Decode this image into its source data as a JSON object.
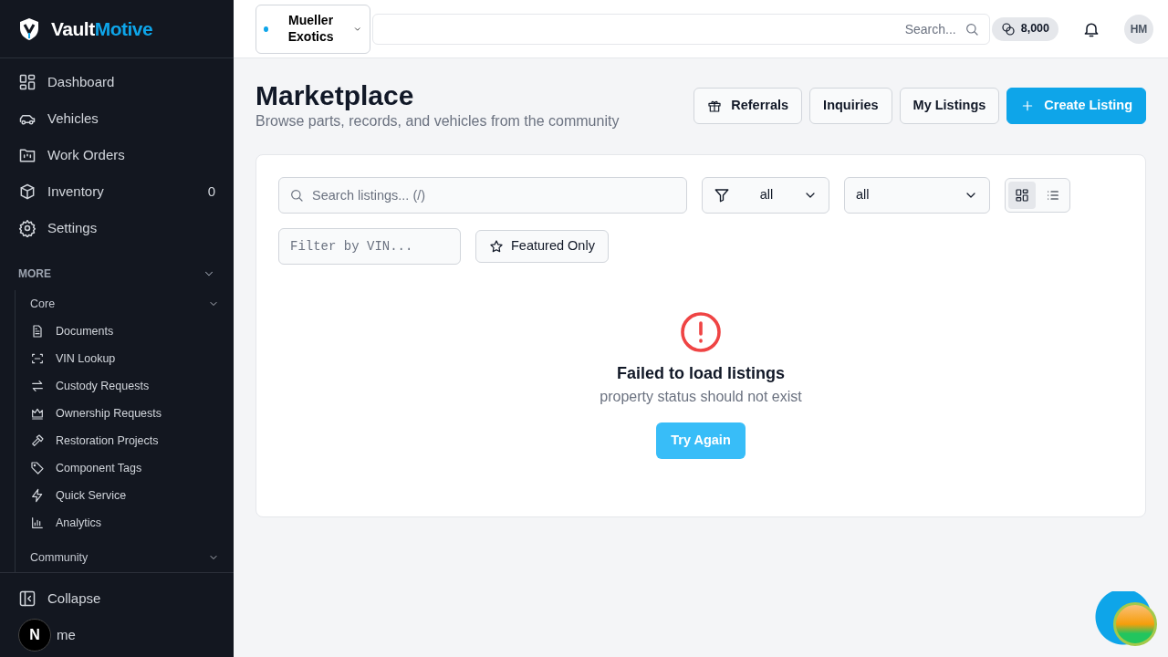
{
  "brand": {
    "part_1": "Vault",
    "part_2": "Motive"
  },
  "sidebar": {
    "items": [
      {
        "label": "Dashboard"
      },
      {
        "label": "Vehicles"
      },
      {
        "label": "Work Orders"
      },
      {
        "label": "Inventory",
        "count": "0"
      },
      {
        "label": "Settings"
      }
    ],
    "more": {
      "label": "MORE",
      "expanded": true,
      "groups": [
        {
          "label": "Core",
          "expanded": true,
          "items": [
            {
              "label": "Documents"
            },
            {
              "label": "VIN Lookup"
            },
            {
              "label": "Custody Requests"
            },
            {
              "label": "Ownership Requests"
            },
            {
              "label": "Restoration Projects"
            },
            {
              "label": "Component Tags"
            },
            {
              "label": "Quick Service"
            },
            {
              "label": "Analytics"
            }
          ]
        },
        {
          "label": "Community",
          "expanded": true
        }
      ]
    },
    "footer": [
      {
        "label": "Collapse"
      },
      {
        "label": "me"
      }
    ],
    "dev_badge": "N"
  },
  "topbar": {
    "workspace": {
      "name": "Mueller Exotics",
      "color": "#0ea5e9"
    },
    "search": {
      "placeholder": "Search..."
    },
    "credits": "8,000",
    "avatar": "HM"
  },
  "page": {
    "title": "Marketplace",
    "subtitle": "Browse parts, records, and vehicles from the community",
    "actions": [
      {
        "label": "Referrals",
        "kind": "gift"
      },
      {
        "label": "Inquiries",
        "kind": "plain"
      },
      {
        "label": "My Listings",
        "kind": "plain"
      },
      {
        "label": "Create Listing",
        "kind": "primary"
      }
    ]
  },
  "filters": {
    "search": {
      "placeholder": "Search listings... (/)"
    },
    "type_select": "all",
    "category_select": "all",
    "views": [
      {
        "kind": "grid",
        "selected": true
      },
      {
        "kind": "list",
        "selected": false
      }
    ],
    "vin": {
      "placeholder": "Filter by VIN..."
    },
    "featured": {
      "label": "Featured Only",
      "on": false
    }
  },
  "error": {
    "title": "Failed to load listings",
    "message": "property status should not exist",
    "button": "Try Again"
  }
}
